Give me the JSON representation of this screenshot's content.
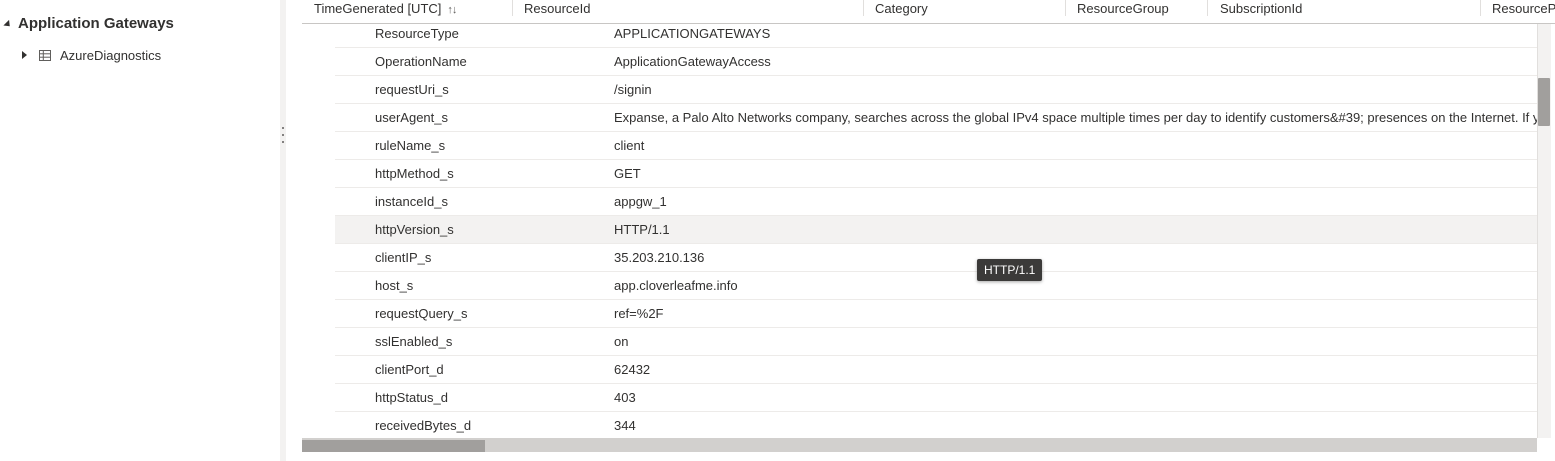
{
  "sidebar": {
    "root_label": "Application Gateways",
    "child_label": "AzureDiagnostics"
  },
  "grid": {
    "columns": [
      "TimeGenerated [UTC]",
      "ResourceId",
      "Category",
      "ResourceGroup",
      "SubscriptionId",
      "ResourceP"
    ],
    "sort_icon": "↑↓",
    "rows": [
      {
        "key": "ResourceType",
        "value": "APPLICATIONGATEWAYS"
      },
      {
        "key": "OperationName",
        "value": "ApplicationGatewayAccess"
      },
      {
        "key": "requestUri_s",
        "value": "/signin"
      },
      {
        "key": "userAgent_s",
        "value": "Expanse, a Palo Alto Networks company, searches across the global IPv4 space multiple times per day to identify customers&#39; presences on the Internet. If you"
      },
      {
        "key": "ruleName_s",
        "value": "client"
      },
      {
        "key": "httpMethod_s",
        "value": "GET"
      },
      {
        "key": "instanceId_s",
        "value": "appgw_1"
      },
      {
        "key": "httpVersion_s",
        "value": "HTTP/1.1"
      },
      {
        "key": "clientIP_s",
        "value": "35.203.210.136"
      },
      {
        "key": "host_s",
        "value": "app.cloverleafme.info"
      },
      {
        "key": "requestQuery_s",
        "value": "ref=%2F"
      },
      {
        "key": "sslEnabled_s",
        "value": "on"
      },
      {
        "key": "clientPort_d",
        "value": "62432"
      },
      {
        "key": "httpStatus_d",
        "value": "403"
      },
      {
        "key": "receivedBytes_d",
        "value": "344"
      }
    ],
    "hovered_row": 7
  },
  "tooltip": {
    "text": "HTTP/1.1"
  },
  "icons": {
    "root_caret": "caret-down-icon",
    "child_caret": "caret-right-icon",
    "table": "table-icon",
    "sort": "sort-icon"
  }
}
